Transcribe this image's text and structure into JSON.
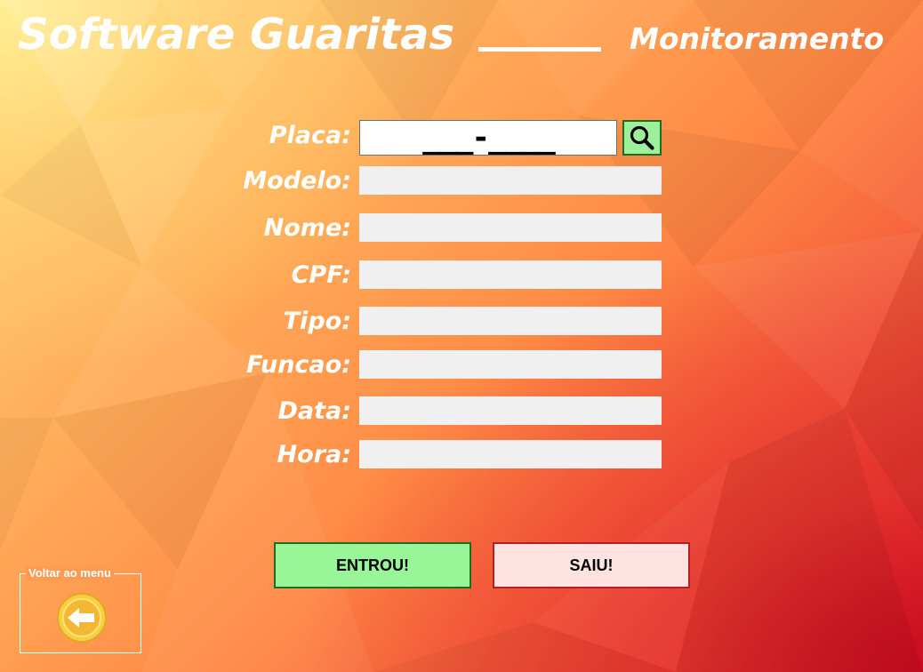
{
  "header": {
    "title": "Software Guaritas",
    "subtitle": "Monitoramento"
  },
  "form": {
    "placa_label": "Placa:",
    "placa_value": "___-____",
    "modelo_label": "Modelo:",
    "nome_label": "Nome:",
    "cpf_label": "CPF:",
    "tipo_label": "Tipo:",
    "funcao_label": "Funcao:",
    "data_label": "Data:",
    "hora_label": "Hora:",
    "modelo_value": "",
    "nome_value": "",
    "cpf_value": "",
    "tipo_value": "",
    "funcao_value": "",
    "data_value": "",
    "hora_value": ""
  },
  "actions": {
    "entrou_label": "ENTROU!",
    "saiu_label": "SAIU!"
  },
  "back": {
    "group_label": "Voltar ao menu"
  },
  "icons": {
    "search": "search-icon",
    "back": "back-arrow-icon"
  },
  "colors": {
    "search_button": "#9cf09c",
    "entrou_button": "#98f598",
    "saiu_button": "#ffe3e1",
    "back_button": "#f5c93c",
    "field_background": "#f0f0f0"
  }
}
